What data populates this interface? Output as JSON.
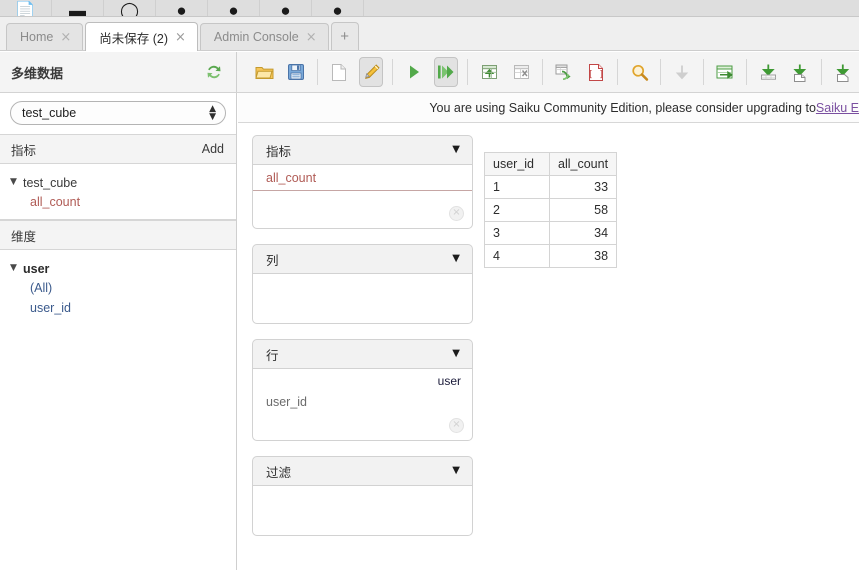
{
  "browser": {
    "icons": [
      "bookmark-icon",
      "window-icon",
      "circle-icon",
      "clock-icon",
      "clock-icon-2",
      "pin-icon",
      "shield-icon"
    ]
  },
  "tabs": {
    "items": [
      {
        "label": "Home",
        "close": "×",
        "active": false
      },
      {
        "label": "尚未保存 (2)",
        "close": "×",
        "active": true
      },
      {
        "label": "Admin Console",
        "close": "×",
        "active": false
      }
    ],
    "add_label": "+"
  },
  "sidebar": {
    "title": "多维数据",
    "refresh_icon": "refresh-icon",
    "cube_select": {
      "value": "test_cube",
      "spinner": "⬍"
    },
    "measures_section": {
      "label": "指标",
      "add_label": "Add"
    },
    "measures_tree": {
      "root": {
        "caret": "▼",
        "label": "test_cube"
      },
      "children": [
        {
          "label": "all_count"
        }
      ]
    },
    "dimensions_section": {
      "label": "维度"
    },
    "dimensions_tree": {
      "root": {
        "caret": "▼",
        "label": "user"
      },
      "children": [
        {
          "label": "(All)"
        },
        {
          "label": "user_id"
        }
      ]
    }
  },
  "toolbar": {
    "buttons": [
      {
        "name": "open-query-button",
        "icon": "folder-open-icon",
        "state": "normal"
      },
      {
        "name": "save-query-button",
        "icon": "floppy-save-icon",
        "state": "normal"
      },
      {
        "name": "new-query-button",
        "icon": "new-document-icon",
        "state": "normal"
      },
      {
        "name": "edit-query-button",
        "icon": "pencil-edit-icon",
        "state": "pressed"
      },
      {
        "name": "run-query-button",
        "icon": "play-icon",
        "state": "normal"
      },
      {
        "name": "automatic-execution-button",
        "icon": "fast-forward-icon",
        "state": "pressed"
      },
      {
        "name": "toggle-fields-button",
        "icon": "table-up-arrow-icon",
        "state": "normal"
      },
      {
        "name": "non-empty-button",
        "icon": "table-x-icon",
        "state": "normal"
      },
      {
        "name": "swap-axes-button",
        "icon": "swap-axes-icon",
        "state": "normal"
      },
      {
        "name": "mdx-query-button",
        "icon": "mdx-brackets-icon",
        "state": "normal"
      },
      {
        "name": "zoom-drillthrough-button",
        "icon": "magnifier-icon",
        "state": "normal"
      },
      {
        "name": "drillthrough-button",
        "icon": "down-arrow-icon",
        "state": "disabled"
      },
      {
        "name": "export-xls-button",
        "icon": "export-table-arrow-icon",
        "state": "normal"
      },
      {
        "name": "export-csv-button",
        "icon": "download-table-icon",
        "state": "normal"
      },
      {
        "name": "export-pdf-button",
        "icon": "download-doc-icon",
        "state": "normal"
      }
    ]
  },
  "banner": {
    "text": "You are using Saiku Community Edition, please consider upgrading to ",
    "link_text": "Saiku E"
  },
  "zones": [
    {
      "name": "measures-zone",
      "title": "指标",
      "caret": "▼",
      "measure_chip": "all_count",
      "dim_label": "",
      "dim_item": "",
      "has_remove": true,
      "remove": "×"
    },
    {
      "name": "columns-zone",
      "title": "列",
      "caret": "▼",
      "measure_chip": "",
      "dim_label": "",
      "dim_item": "",
      "has_remove": false,
      "remove": ""
    },
    {
      "name": "rows-zone",
      "title": "行",
      "caret": "▼",
      "measure_chip": "",
      "dim_label": "user",
      "dim_item": "user_id",
      "has_remove": true,
      "remove": "×"
    },
    {
      "name": "filter-zone",
      "title": "过滤",
      "caret": "▼",
      "measure_chip": "",
      "dim_label": "",
      "dim_item": "",
      "has_remove": false,
      "remove": ""
    }
  ],
  "results": {
    "columns": [
      "user_id",
      "all_count"
    ],
    "rows": [
      {
        "user_id": "1",
        "all_count": "33"
      },
      {
        "user_id": "2",
        "all_count": "58"
      },
      {
        "user_id": "3",
        "all_count": "34"
      },
      {
        "user_id": "4",
        "all_count": "38"
      }
    ]
  },
  "colors": {
    "measure_red": "#b05b55",
    "dimension_blue": "#3b5a8c",
    "link_purple": "#7a4fa0",
    "toolbar_bg": "#f4f4f4",
    "zone_header_bg": "#f2f2f2"
  }
}
